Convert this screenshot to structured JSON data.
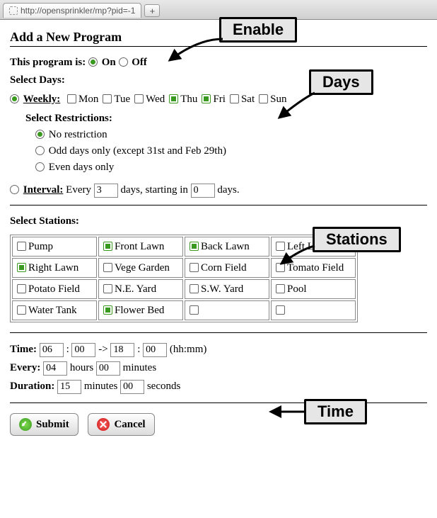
{
  "tab": {
    "url": "http://opensprinkler/mp?pid=-1"
  },
  "title": "Add a New Program",
  "enable": {
    "label": "This program is:",
    "on": "On",
    "off": "Off",
    "value": "on"
  },
  "days": {
    "label": "Select Days:",
    "weekly_label": "Weekly:",
    "weekdays": [
      {
        "label": "Mon",
        "checked": false
      },
      {
        "label": "Tue",
        "checked": false
      },
      {
        "label": "Wed",
        "checked": false
      },
      {
        "label": "Thu",
        "checked": true
      },
      {
        "label": "Fri",
        "checked": true
      },
      {
        "label": "Sat",
        "checked": false
      },
      {
        "label": "Sun",
        "checked": false
      }
    ],
    "restrictions_label": "Select Restrictions:",
    "restrictions": {
      "none": "No restriction",
      "odd": "Odd days only (except 31st and Feb 29th)",
      "even": "Even days only",
      "selected": "none"
    },
    "interval": {
      "label": "Interval:",
      "pre": "Every",
      "mid": "days, starting in",
      "post": "days.",
      "every": "3",
      "start": "0"
    },
    "schedule_mode": "weekly"
  },
  "stations": {
    "label": "Select Stations:",
    "grid": [
      [
        {
          "label": "Pump",
          "checked": false
        },
        {
          "label": "Front Lawn",
          "checked": true
        },
        {
          "label": "Back Lawn",
          "checked": true
        },
        {
          "label": "Left Lawn",
          "checked": false
        }
      ],
      [
        {
          "label": "Right Lawn",
          "checked": true
        },
        {
          "label": "Vege Garden",
          "checked": false
        },
        {
          "label": "Corn Field",
          "checked": false
        },
        {
          "label": "Tomato Field",
          "checked": false
        }
      ],
      [
        {
          "label": "Potato Field",
          "checked": false
        },
        {
          "label": "N.E. Yard",
          "checked": false
        },
        {
          "label": "S.W. Yard",
          "checked": false
        },
        {
          "label": "Pool",
          "checked": false
        }
      ],
      [
        {
          "label": "Water Tank",
          "checked": false
        },
        {
          "label": "Flower Bed",
          "checked": true
        },
        {
          "label": "",
          "checked": false
        },
        {
          "label": "",
          "checked": false
        }
      ]
    ]
  },
  "time": {
    "time_label": "Time:",
    "start_h": "06",
    "start_m": "00",
    "arrow": "->",
    "end_h": "18",
    "end_m": "00",
    "hhmm": "(hh:mm)",
    "every_label": "Every:",
    "every_h": "04",
    "hours": "hours",
    "every_m": "00",
    "minutes": "minutes",
    "duration_label": "Duration:",
    "dur_m": "15",
    "dur_minutes": "minutes",
    "dur_s": "00",
    "seconds": "seconds"
  },
  "buttons": {
    "submit": "Submit",
    "cancel": "Cancel"
  },
  "callouts": {
    "enable": "Enable",
    "days": "Days",
    "stations": "Stations",
    "time": "Time"
  }
}
